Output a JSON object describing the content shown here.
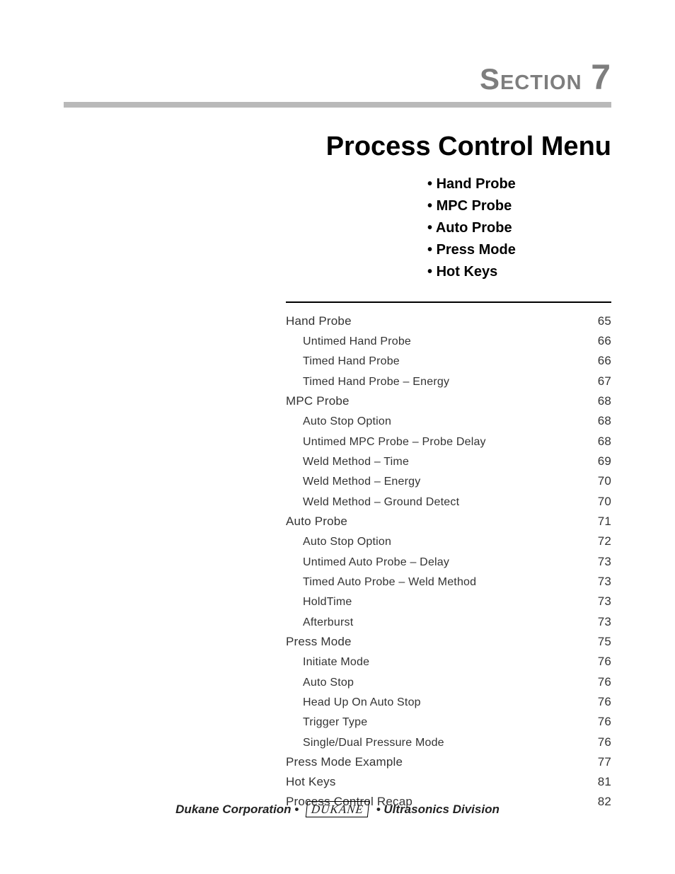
{
  "section_label_prefix": "Section",
  "section_number": "7",
  "title": "Process Control Menu",
  "bullets": [
    "Hand Probe",
    "MPC Probe",
    "Auto Probe",
    "Press Mode",
    "Hot Keys"
  ],
  "toc": [
    {
      "label": "Hand Probe",
      "page": "65",
      "sub": false
    },
    {
      "label": "Untimed Hand Probe",
      "page": "66",
      "sub": true
    },
    {
      "label": "Timed Hand Probe",
      "page": "66",
      "sub": true
    },
    {
      "label": "Timed Hand Probe – Energy",
      "page": "67",
      "sub": true
    },
    {
      "label": "MPC Probe",
      "page": "68",
      "sub": false
    },
    {
      "label": "Auto Stop Option",
      "page": "68",
      "sub": true
    },
    {
      "label": "Untimed MPC Probe – Probe Delay",
      "page": "68",
      "sub": true
    },
    {
      "label": "Weld Method – Time",
      "page": "69",
      "sub": true
    },
    {
      "label": "Weld Method – Energy",
      "page": "70",
      "sub": true
    },
    {
      "label": "Weld Method – Ground Detect",
      "page": "70",
      "sub": true
    },
    {
      "label": "Auto Probe",
      "page": "71",
      "sub": false
    },
    {
      "label": "Auto Stop Option",
      "page": "72",
      "sub": true
    },
    {
      "label": "Untimed Auto Probe – Delay",
      "page": "73",
      "sub": true
    },
    {
      "label": "Timed Auto Probe – Weld Method",
      "page": "73",
      "sub": true
    },
    {
      "label": "HoldTime",
      "page": "73",
      "sub": true
    },
    {
      "label": "Afterburst",
      "page": "73",
      "sub": true
    },
    {
      "label": "Press Mode",
      "page": "75",
      "sub": false
    },
    {
      "label": "Initiate Mode",
      "page": "76",
      "sub": true
    },
    {
      "label": "Auto Stop",
      "page": "76",
      "sub": true
    },
    {
      "label": "Head Up On Auto Stop",
      "page": "76",
      "sub": true
    },
    {
      "label": "Trigger Type",
      "page": "76",
      "sub": true
    },
    {
      "label": "Single/Dual Pressure Mode",
      "page": "76",
      "sub": true
    },
    {
      "label": "Press Mode Example",
      "page": "77",
      "sub": false
    },
    {
      "label": "Hot Keys",
      "page": "81",
      "sub": false
    },
    {
      "label": "Process Control Recap",
      "page": "82",
      "sub": false
    }
  ],
  "footer": {
    "left": "Dukane Corporation",
    "logo": "DUKANE",
    "right": "Ultrasonics Division",
    "sep": "•"
  }
}
